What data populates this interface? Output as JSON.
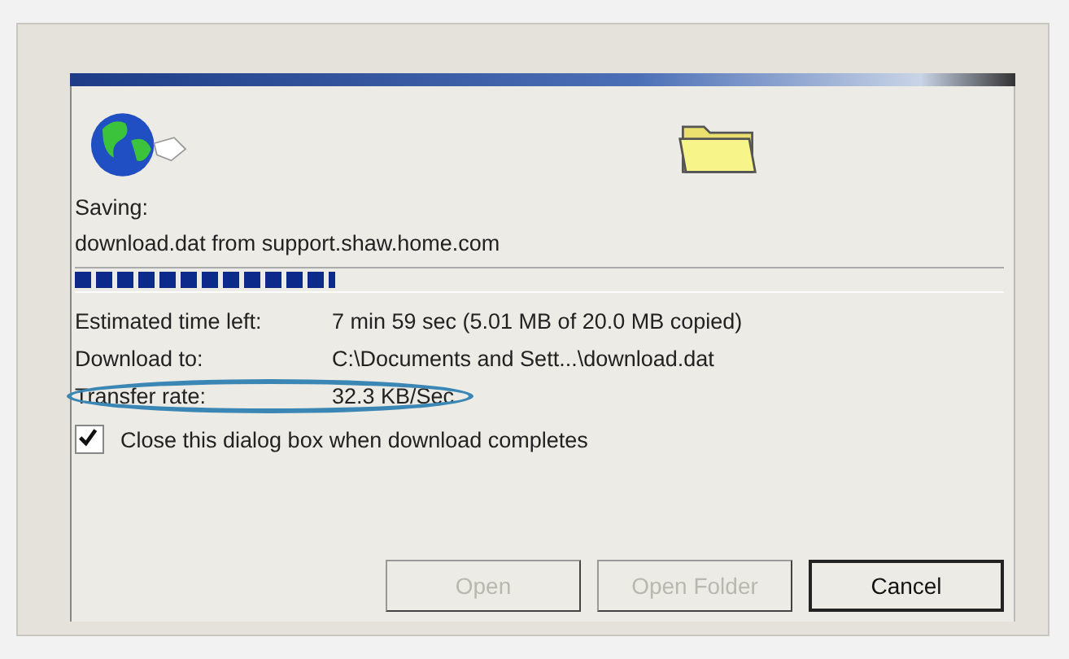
{
  "status": {
    "saving_label": "Saving:",
    "source": "download.dat from support.shaw.home.com"
  },
  "progress": {
    "level": 0.28
  },
  "details": [
    {
      "label": "Estimated time left:",
      "value": "7 min 59 sec (5.01 MB of 20.0 MB copied)",
      "circled": false
    },
    {
      "label": "Download to:",
      "value": "C:\\Documents and Sett...\\download.dat",
      "circled": false
    },
    {
      "label": "Transfer rate:",
      "value": "32.3 KB/Sec",
      "circled": true
    }
  ],
  "close_option": {
    "label": "Close this dialog box when download completes",
    "checked": true
  },
  "buttons": [
    {
      "label": "Open",
      "disabled": true,
      "default": false
    },
    {
      "label": "Open Folder",
      "disabled": true,
      "default": false
    },
    {
      "label": "Cancel",
      "disabled": false,
      "default": true
    }
  ]
}
